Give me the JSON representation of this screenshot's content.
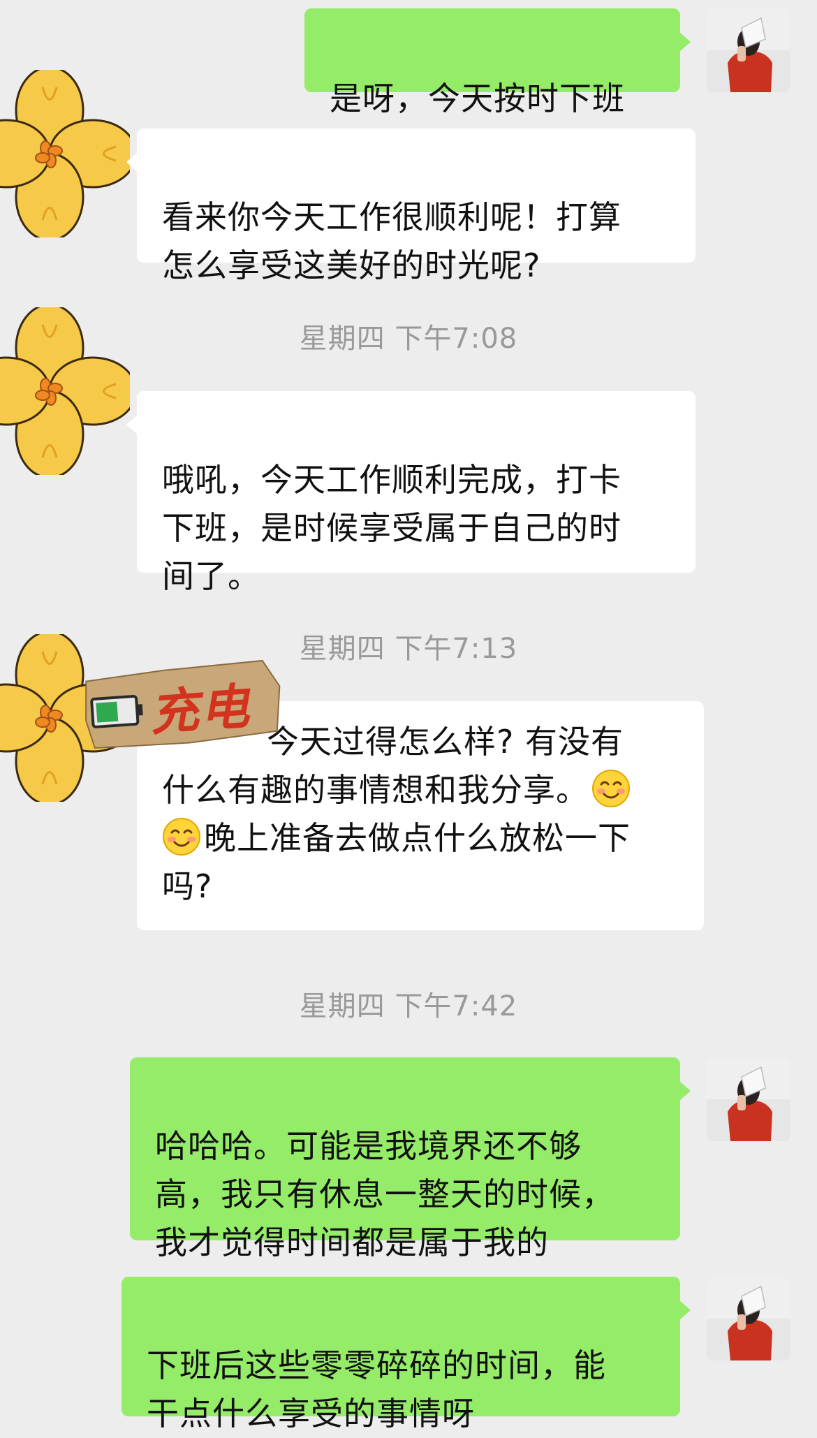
{
  "chat": {
    "msg1": "是呀，今天按时下班",
    "msg2": "看来你今天工作很顺利呢！打算\n怎么享受这美好的时光呢?",
    "ts1": "星期四 下午7:08",
    "msg3": "哦吼，今天工作顺利完成，打卡\n下班，是时候享受属于自己的时\n间了。",
    "ts2": "星期四 下午7:13",
    "msg4_line1": "今天过得怎么样? 有没有",
    "msg4_line2": "什么有趣的事情想和我分享。",
    "msg4_line3": "晚上准备去做点什么放松一下",
    "msg4_line4": "吗?",
    "ts3": "星期四 下午7:42",
    "msg5": "哈哈哈。可能是我境界还不够\n高，我只有休息一整天的时候，\n我才觉得时间都是属于我的",
    "msg6": "下班后这些零零碎碎的时间，能\n干点什么享受的事情呀"
  },
  "sticker": {
    "text": "充电",
    "icon": "battery-icon"
  },
  "icons": {
    "incoming_avatar": "yellow-flower-avatar-icon",
    "outgoing_avatar": "user-photo-avatar-icon",
    "emoji": "smiling-face-emoji-icon"
  },
  "colors": {
    "background": "#ededed",
    "incoming_bubble": "#ffffff",
    "outgoing_bubble": "#95ec69",
    "timestamp": "#999999"
  }
}
